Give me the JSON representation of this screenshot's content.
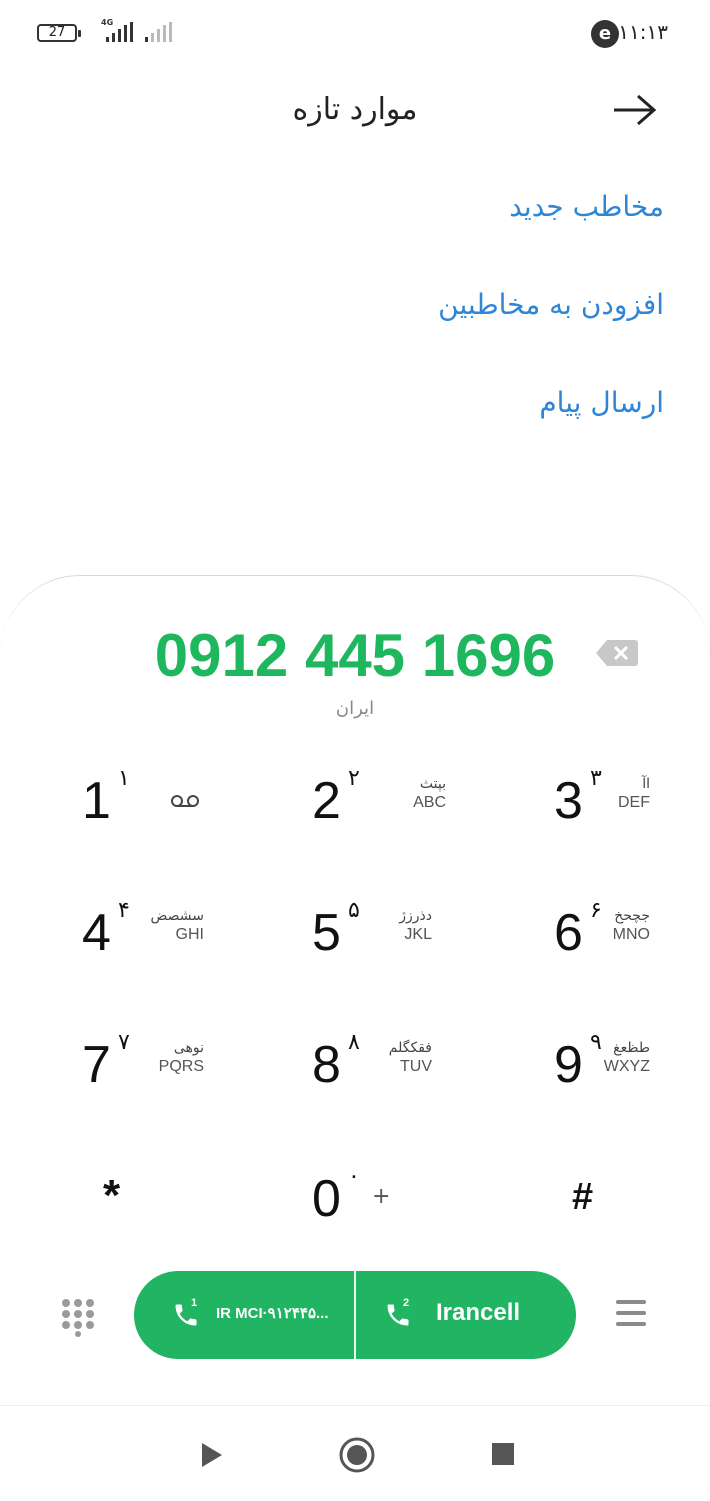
{
  "status_bar": {
    "battery": "27",
    "network": "4G",
    "time": "۱۱:۱۳",
    "app_badge": "e"
  },
  "header": {
    "title": "موارد تازه"
  },
  "options": [
    {
      "label": "مخاطب جدید"
    },
    {
      "label": "افزودن به مخاطبین"
    },
    {
      "label": "ارسال پیام"
    }
  ],
  "dialer": {
    "number": "0912 445 1696",
    "country": "ایران",
    "keys": [
      {
        "digit": "1",
        "sup": "۱",
        "fa": "",
        "en": ""
      },
      {
        "digit": "2",
        "sup": "۲",
        "fa": "بپتث",
        "en": "ABC"
      },
      {
        "digit": "3",
        "sup": "۳",
        "fa": "اآ",
        "en": "DEF"
      },
      {
        "digit": "4",
        "sup": "۴",
        "fa": "سشصض",
        "en": "GHI"
      },
      {
        "digit": "5",
        "sup": "۵",
        "fa": "دذرزژ",
        "en": "JKL"
      },
      {
        "digit": "6",
        "sup": "۶",
        "fa": "جچحخ",
        "en": "MNO"
      },
      {
        "digit": "7",
        "sup": "۷",
        "fa": "نوهی",
        "en": "PQRS"
      },
      {
        "digit": "8",
        "sup": "۸",
        "fa": "فقکگلم",
        "en": "TUV"
      },
      {
        "digit": "9",
        "sup": "۹",
        "fa": "طظعغ",
        "en": "WXYZ"
      }
    ],
    "star": "*",
    "zero": "0",
    "zero_sup": "۰",
    "plus": "+",
    "hash": "#"
  },
  "call_bar": {
    "sim1_index": "1",
    "sim1_label": "IR MCI·۹۱۲۴۴۵...",
    "sim2_index": "2",
    "sim2_label": "Irancell",
    "accent": "#20b463"
  },
  "colors": {
    "number_green": "#1fb75e",
    "link_blue": "#2f86d6"
  }
}
